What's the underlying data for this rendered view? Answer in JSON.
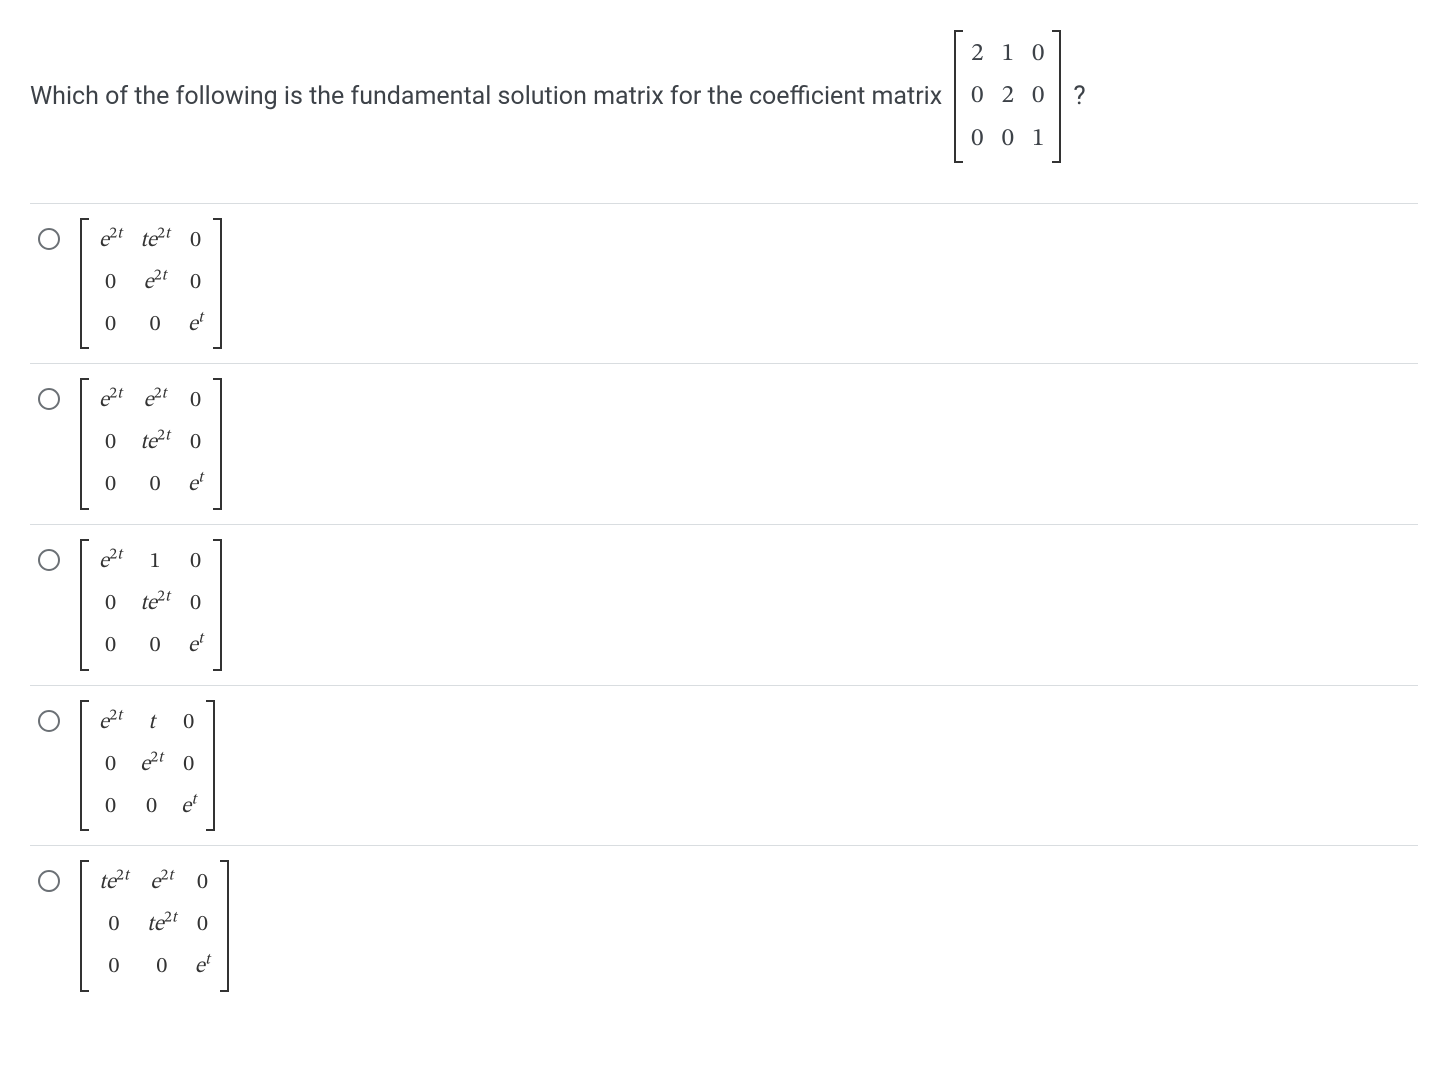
{
  "question": {
    "text_before": "Which of the following is the fundamental solution matrix for the coefficient matrix",
    "text_after": "?",
    "matrix": [
      [
        "2",
        "1",
        "0"
      ],
      [
        "0",
        "2",
        "0"
      ],
      [
        "0",
        "0",
        "1"
      ]
    ]
  },
  "options": [
    {
      "id": "A",
      "matrix": [
        [
          "e^{2t}",
          "te^{2t}",
          "0"
        ],
        [
          "0",
          "e^{2t}",
          "0"
        ],
        [
          "0",
          "0",
          "e^{t}"
        ]
      ]
    },
    {
      "id": "B",
      "matrix": [
        [
          "e^{2t}",
          "e^{2t}",
          "0"
        ],
        [
          "0",
          "te^{2t}",
          "0"
        ],
        [
          "0",
          "0",
          "e^{t}"
        ]
      ]
    },
    {
      "id": "C",
      "matrix": [
        [
          "e^{2t}",
          "1",
          "0"
        ],
        [
          "0",
          "te^{2t}",
          "0"
        ],
        [
          "0",
          "0",
          "e^{t}"
        ]
      ]
    },
    {
      "id": "D",
      "matrix": [
        [
          "e^{2t}",
          "t",
          "0"
        ],
        [
          "0",
          "e^{2t}",
          "0"
        ],
        [
          "0",
          "0",
          "e^{t}"
        ]
      ]
    },
    {
      "id": "E",
      "matrix": [
        [
          "te^{2t}",
          "e^{2t}",
          "0"
        ],
        [
          "0",
          "te^{2t}",
          "0"
        ],
        [
          "0",
          "0",
          "e^{t}"
        ]
      ]
    }
  ]
}
